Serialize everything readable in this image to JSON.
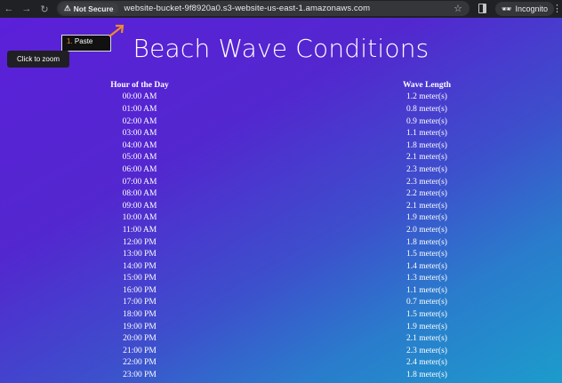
{
  "browser": {
    "security_label": "Not Secure",
    "url": "website-bucket-9f8920a0.s3-website-us-east-1.amazonaws.com",
    "profile_label": "Incognito"
  },
  "overlay": {
    "step_number": "1.",
    "step_label": "Paste",
    "zoom_tooltip": "Click to zoom"
  },
  "page": {
    "title": "Beach Wave Conditions",
    "columns": [
      "Hour of the Day",
      "Wave Length"
    ],
    "rows": [
      [
        "00:00 AM",
        "1.2 meter(s)"
      ],
      [
        "01:00 AM",
        "0.8 meter(s)"
      ],
      [
        "02:00 AM",
        "0.9 meter(s)"
      ],
      [
        "03:00 AM",
        "1.1 meter(s)"
      ],
      [
        "04:00 AM",
        "1.8 meter(s)"
      ],
      [
        "05:00 AM",
        "2.1 meter(s)"
      ],
      [
        "06:00 AM",
        "2.3 meter(s)"
      ],
      [
        "07:00 AM",
        "2.3 meter(s)"
      ],
      [
        "08:00 AM",
        "2.2 meter(s)"
      ],
      [
        "09:00 AM",
        "2.1 meter(s)"
      ],
      [
        "10:00 AM",
        "1.9 meter(s)"
      ],
      [
        "11:00 AM",
        "2.0 meter(s)"
      ],
      [
        "12:00 PM",
        "1.8 meter(s)"
      ],
      [
        "13:00 PM",
        "1.5 meter(s)"
      ],
      [
        "14:00 PM",
        "1.4 meter(s)"
      ],
      [
        "15:00 PM",
        "1.3 meter(s)"
      ],
      [
        "16:00 PM",
        "1.1 meter(s)"
      ],
      [
        "17:00 PM",
        "0.7 meter(s)"
      ],
      [
        "18:00 PM",
        "1.5 meter(s)"
      ],
      [
        "19:00 PM",
        "1.9 meter(s)"
      ],
      [
        "20:00 PM",
        "2.1 meter(s)"
      ],
      [
        "21:00 PM",
        "2.3 meter(s)"
      ],
      [
        "22:00 PM",
        "2.4 meter(s)"
      ],
      [
        "23:00 PM",
        "1.8 meter(s)"
      ]
    ]
  },
  "colors": {
    "chrome_bg": "#202124",
    "gradient_start": "#5b20d9",
    "gradient_end": "#1c9ccc",
    "accent_orange": "#f08a2c"
  }
}
